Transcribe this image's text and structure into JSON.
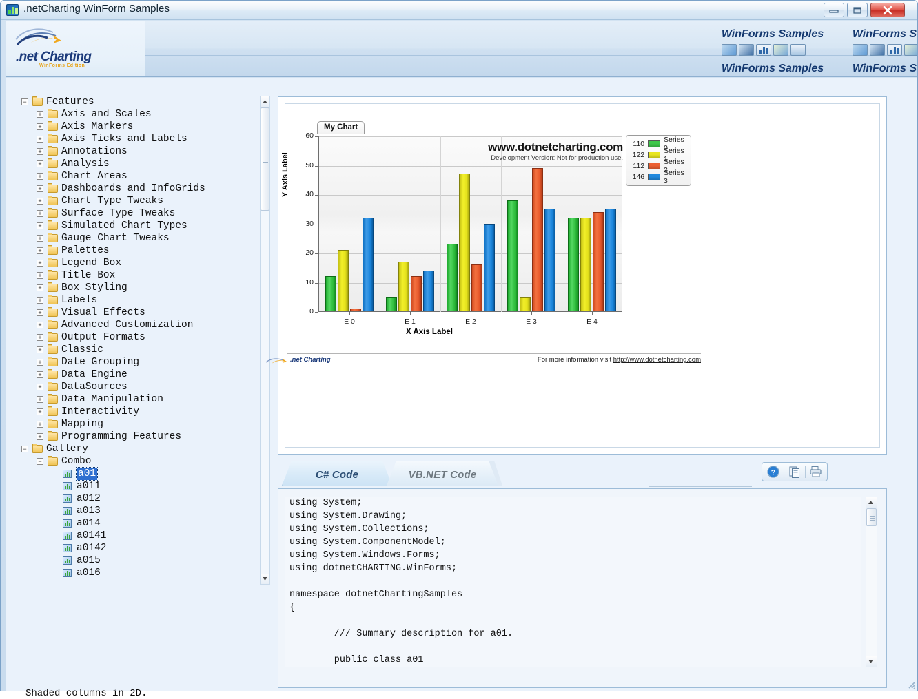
{
  "window": {
    "title": ".netCharting WinForm Samples",
    "icon": "chart-app-icon",
    "buttons": {
      "minimize": "Minimize",
      "maximize": "Maximize",
      "close": "Close"
    }
  },
  "banner": {
    "logo_text": ".net Charting",
    "logo_subtext": "WinForms Edition",
    "repeat_title": "WinForms Samples",
    "icons": [
      "globe-icon",
      "monitor-icon",
      "bar-chart-icon",
      "export-icon",
      "print-icon"
    ]
  },
  "tree": {
    "nodes": [
      {
        "label": "Features",
        "depth": 0,
        "expander": "minus",
        "icon": "folder-icon"
      },
      {
        "label": "Axis and Scales",
        "depth": 1,
        "expander": "plus",
        "icon": "folder-icon"
      },
      {
        "label": "Axis Markers",
        "depth": 1,
        "expander": "plus",
        "icon": "folder-icon"
      },
      {
        "label": "Axis Ticks and Labels",
        "depth": 1,
        "expander": "plus",
        "icon": "folder-icon"
      },
      {
        "label": "Annotations",
        "depth": 1,
        "expander": "plus",
        "icon": "folder-icon"
      },
      {
        "label": "Analysis",
        "depth": 1,
        "expander": "plus",
        "icon": "folder-icon"
      },
      {
        "label": "Chart Areas",
        "depth": 1,
        "expander": "plus",
        "icon": "folder-icon"
      },
      {
        "label": "Dashboards and InfoGrids",
        "depth": 1,
        "expander": "plus",
        "icon": "folder-icon"
      },
      {
        "label": "Chart Type Tweaks",
        "depth": 1,
        "expander": "plus",
        "icon": "folder-icon"
      },
      {
        "label": "Surface Type Tweaks",
        "depth": 1,
        "expander": "plus",
        "icon": "folder-icon"
      },
      {
        "label": "Simulated Chart Types",
        "depth": 1,
        "expander": "plus",
        "icon": "folder-icon"
      },
      {
        "label": "Gauge Chart Tweaks",
        "depth": 1,
        "expander": "plus",
        "icon": "folder-icon"
      },
      {
        "label": "Palettes",
        "depth": 1,
        "expander": "plus",
        "icon": "folder-icon"
      },
      {
        "label": "Legend Box",
        "depth": 1,
        "expander": "plus",
        "icon": "folder-icon"
      },
      {
        "label": "Title Box",
        "depth": 1,
        "expander": "plus",
        "icon": "folder-icon"
      },
      {
        "label": "Box Styling",
        "depth": 1,
        "expander": "plus",
        "icon": "folder-icon"
      },
      {
        "label": "Labels",
        "depth": 1,
        "expander": "plus",
        "icon": "folder-icon"
      },
      {
        "label": "Visual Effects",
        "depth": 1,
        "expander": "plus",
        "icon": "folder-icon"
      },
      {
        "label": "Advanced Customization",
        "depth": 1,
        "expander": "plus",
        "icon": "folder-icon"
      },
      {
        "label": "Output Formats",
        "depth": 1,
        "expander": "plus",
        "icon": "folder-icon"
      },
      {
        "label": "Classic",
        "depth": 1,
        "expander": "plus",
        "icon": "folder-icon"
      },
      {
        "label": "Date Grouping",
        "depth": 1,
        "expander": "plus",
        "icon": "folder-icon"
      },
      {
        "label": "Data Engine",
        "depth": 1,
        "expander": "plus",
        "icon": "folder-icon"
      },
      {
        "label": "DataSources",
        "depth": 1,
        "expander": "plus",
        "icon": "folder-icon"
      },
      {
        "label": "Data Manipulation",
        "depth": 1,
        "expander": "plus",
        "icon": "folder-icon"
      },
      {
        "label": "Interactivity",
        "depth": 1,
        "expander": "plus",
        "icon": "folder-icon"
      },
      {
        "label": "Mapping",
        "depth": 1,
        "expander": "plus",
        "icon": "folder-icon"
      },
      {
        "label": "Programming Features",
        "depth": 1,
        "expander": "plus",
        "icon": "folder-icon"
      },
      {
        "label": "Gallery",
        "depth": 0,
        "expander": "minus",
        "icon": "folder-icon"
      },
      {
        "label": "Combo",
        "depth": 1,
        "expander": "minus",
        "icon": "folder-icon"
      },
      {
        "label": "a01",
        "depth": 2,
        "expander": "none",
        "icon": "chart-file-icon",
        "selected": true
      },
      {
        "label": "a011",
        "depth": 2,
        "expander": "none",
        "icon": "chart-file-icon"
      },
      {
        "label": "a012",
        "depth": 2,
        "expander": "none",
        "icon": "chart-file-icon"
      },
      {
        "label": "a013",
        "depth": 2,
        "expander": "none",
        "icon": "chart-file-icon"
      },
      {
        "label": "a014",
        "depth": 2,
        "expander": "none",
        "icon": "chart-file-icon"
      },
      {
        "label": "a0141",
        "depth": 2,
        "expander": "none",
        "icon": "chart-file-icon"
      },
      {
        "label": "a0142",
        "depth": 2,
        "expander": "none",
        "icon": "chart-file-icon"
      },
      {
        "label": "a015",
        "depth": 2,
        "expander": "none",
        "icon": "chart-file-icon"
      },
      {
        "label": "a016",
        "depth": 2,
        "expander": "none",
        "icon": "chart-file-icon"
      }
    ]
  },
  "status": {
    "text": "Shaded columns in 2D."
  },
  "chart_data": {
    "type": "bar",
    "title": "My Chart",
    "xlabel": "X Axis Label",
    "ylabel": "Y Axis Label",
    "categories": [
      "E 0",
      "E 1",
      "E 2",
      "E 3",
      "E 4"
    ],
    "yticks": [
      0,
      10,
      20,
      30,
      40,
      50,
      60
    ],
    "ylim": [
      0,
      60
    ],
    "grid": true,
    "legend_position": "top-right",
    "watermark_line1": "www.dotnetcharting.com",
    "watermark_line2": "Development Version: Not for production use.",
    "series": [
      {
        "name": "Series 0",
        "total": 110,
        "color": "#3ec84a",
        "values": [
          12,
          5,
          23,
          38,
          32
        ]
      },
      {
        "name": "Series 1",
        "total": 122,
        "color": "#e9e61f",
        "values": [
          21,
          17,
          47,
          5,
          32
        ]
      },
      {
        "name": "Series 2",
        "total": 112,
        "color": "#ec5f31",
        "values": [
          1,
          12,
          16,
          49,
          34
        ]
      },
      {
        "name": "Series 3",
        "total": 146,
        "color": "#2189de",
        "values": [
          32,
          14,
          30,
          35,
          35
        ]
      }
    ]
  },
  "chart_footer": {
    "logo": ".net Charting",
    "info": "For more information visit ",
    "link": "http://www.dotnetcharting.com"
  },
  "code_tabs": {
    "csharp": "C# Code",
    "vbnet": "VB.NET Code"
  },
  "toolbar": {
    "help": "help-icon",
    "copy": "copy-icon",
    "print": "print-icon"
  },
  "code": {
    "text": "using System;\nusing System.Drawing;\nusing System.Collections;\nusing System.ComponentModel;\nusing System.Windows.Forms;\nusing dotnetCHARTING.WinForms;\n\nnamespace dotnetChartingSamples\n{\n\n        /// Summary description for a01.\n\n        public class a01"
  }
}
